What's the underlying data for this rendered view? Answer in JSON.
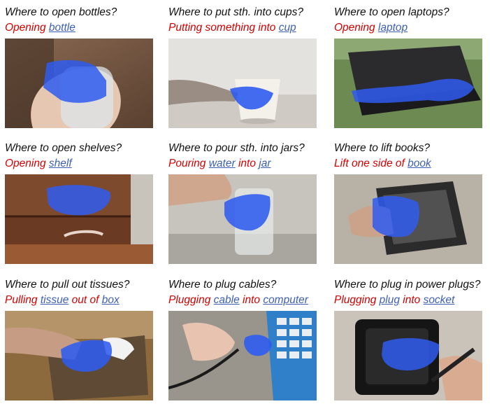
{
  "panels": [
    {
      "question": "Where to open bottles?",
      "answer": [
        {
          "t": "Opening ",
          "k": "w"
        },
        {
          "t": "bottle",
          "k": "o"
        }
      ]
    },
    {
      "question": "Where to put sth. into cups?",
      "answer": [
        {
          "t": "Putting something into ",
          "k": "w"
        },
        {
          "t": "cup",
          "k": "o"
        }
      ]
    },
    {
      "question": "Where to open laptops?",
      "answer": [
        {
          "t": "Opening ",
          "k": "w"
        },
        {
          "t": "laptop",
          "k": "o"
        }
      ]
    },
    {
      "question": "Where to open shelves?",
      "answer": [
        {
          "t": "Opening ",
          "k": "w"
        },
        {
          "t": "shelf",
          "k": "o"
        }
      ]
    },
    {
      "question": "Where to pour sth. into jars?",
      "answer": [
        {
          "t": "Pouring ",
          "k": "w"
        },
        {
          "t": "water",
          "k": "o"
        },
        {
          "t": " into ",
          "k": "w"
        },
        {
          "t": "jar",
          "k": "o"
        }
      ]
    },
    {
      "question": "Where to lift books?",
      "answer": [
        {
          "t": "Lift one side of ",
          "k": "w"
        },
        {
          "t": "book",
          "k": "o"
        }
      ]
    },
    {
      "question": "Where to pull out tissues?",
      "answer": [
        {
          "t": "Pulling ",
          "k": "w"
        },
        {
          "t": "tissue",
          "k": "o"
        },
        {
          "t": " out of ",
          "k": "w"
        },
        {
          "t": "box",
          "k": "o"
        }
      ]
    },
    {
      "question": "Where to plug cables?",
      "answer": [
        {
          "t": "Plugging ",
          "k": "w"
        },
        {
          "t": "cable",
          "k": "o"
        },
        {
          "t": " into ",
          "k": "w"
        },
        {
          "t": "computer",
          "k": "o"
        }
      ]
    },
    {
      "question": "Where to plug in power plugs?",
      "answer": [
        {
          "t": "Plugging ",
          "k": "w"
        },
        {
          "t": "plug",
          "k": "o"
        },
        {
          "t": " into ",
          "k": "w"
        },
        {
          "t": "socket",
          "k": "o"
        }
      ]
    }
  ],
  "colors": {
    "verb": "#d40000",
    "object": "#3d5fb3",
    "mask": "#2f5cf0"
  }
}
